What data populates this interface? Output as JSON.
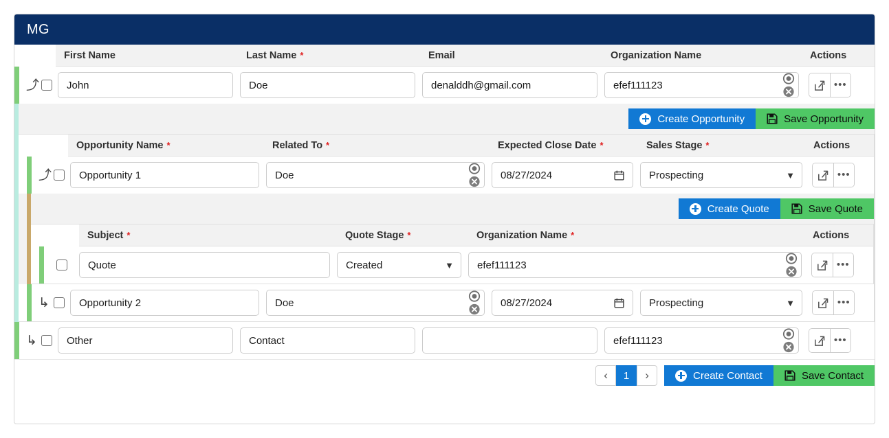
{
  "header": {
    "title": "MG"
  },
  "contact_table": {
    "columns": [
      {
        "label": "First Name",
        "required": false
      },
      {
        "label": "Last Name",
        "required": true
      },
      {
        "label": "Email",
        "required": false
      },
      {
        "label": "Organization Name",
        "required": false
      },
      {
        "label": "Actions",
        "required": false
      }
    ],
    "rows": [
      {
        "row_icon": "arrow-up-turn-icon",
        "checked": false,
        "first_name": "John",
        "last_name": "Doe",
        "email": "denalddh@gmail.com",
        "organization_name": "efef111123"
      },
      {
        "row_icon": "arrow-down-right-icon",
        "checked": false,
        "first_name": "Other",
        "last_name": "Contact",
        "email": "",
        "organization_name": "efef111123"
      }
    ]
  },
  "opportunity_buttons": {
    "create_label": "Create Opportunity",
    "save_label": "Save Opportunity"
  },
  "opportunity_table": {
    "columns": [
      {
        "label": "Opportunity Name",
        "required": true
      },
      {
        "label": "Related To",
        "required": true
      },
      {
        "label": "Expected Close Date",
        "required": true
      },
      {
        "label": "Sales Stage",
        "required": true
      },
      {
        "label": "Actions",
        "required": false
      }
    ],
    "rows": [
      {
        "row_icon": "arrow-up-turn-icon",
        "checked": false,
        "opportunity_name": "Opportunity 1",
        "related_to": "Doe",
        "expected_close_date": "08/27/2024",
        "sales_stage": "Prospecting"
      },
      {
        "row_icon": "arrow-down-right-icon",
        "checked": false,
        "opportunity_name": "Opportunity 2",
        "related_to": "Doe",
        "expected_close_date": "08/27/2024",
        "sales_stage": "Prospecting"
      }
    ]
  },
  "quote_buttons": {
    "create_label": "Create Quote",
    "save_label": "Save Quote"
  },
  "quote_table": {
    "columns": [
      {
        "label": "Subject",
        "required": true
      },
      {
        "label": "Quote Stage",
        "required": true
      },
      {
        "label": "Organization Name",
        "required": true
      },
      {
        "label": "Actions",
        "required": false
      }
    ],
    "rows": [
      {
        "checked": false,
        "subject": "Quote",
        "quote_stage": "Created",
        "organization_name": "efef111123"
      }
    ]
  },
  "footer": {
    "prev_label": "‹",
    "page_number": "1",
    "next_label": "›",
    "create_label": "Create Contact",
    "save_label": "Save Contact"
  },
  "icons": {
    "arrow_up_turn": "⤴",
    "arrow_down_right": "↳",
    "ellipsis": "•••"
  },
  "colors": {
    "titlebar": "#0a2f66",
    "create_button": "#1179d4",
    "save_button": "#4fc765",
    "row_accent": "#7fce79",
    "opportunity_nest_bar": "#b9ece0",
    "quote_nest_bar": "#c9a86a",
    "required_asterisk": "#e02020"
  }
}
